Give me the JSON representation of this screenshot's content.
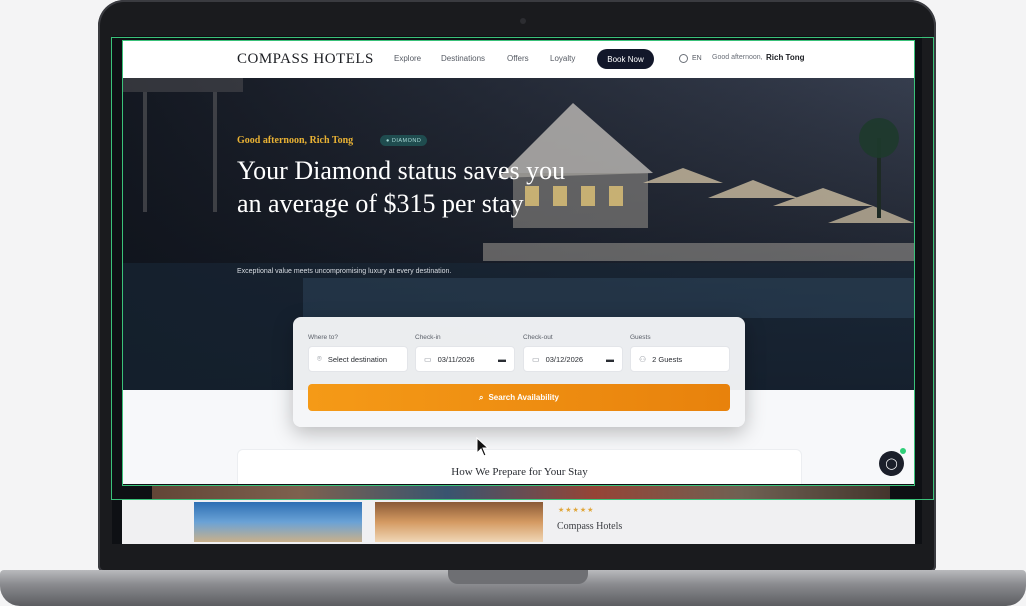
{
  "nav": {
    "brand": "COMPASS HOTELS",
    "links": [
      "Explore",
      "Destinations",
      "Offers",
      "Loyalty"
    ],
    "book_now": "Book Now",
    "language": "EN",
    "greeting": "Good afternoon,",
    "user_name": "Rich Tong"
  },
  "hero": {
    "greeting": "Good afternoon, Rich Tong",
    "badge": "● DIAMOND",
    "headline": "Your Diamond status saves you an average of $315 per stay",
    "subtitle": "Exceptional value meets uncompromising luxury at every destination."
  },
  "search": {
    "where_label": "Where to?",
    "where_value": "Select destination",
    "checkin_label": "Check-in",
    "checkin_value": "03/11/2026",
    "checkout_label": "Check-out",
    "checkout_value": "03/12/2026",
    "guests_label": "Guests",
    "guests_value": "2 Guests",
    "button": "Search Availability"
  },
  "prepare": {
    "title": "How We Prepare for Your Stay"
  },
  "lower": {
    "stars": "★★★★★",
    "brand_partial": "Compass Hotels"
  },
  "colors": {
    "accent": "#f59a17",
    "navy": "#12172a",
    "gold": "#e9b234",
    "badge_bg": "#1f4c4f",
    "frame": "#3ac27a"
  }
}
